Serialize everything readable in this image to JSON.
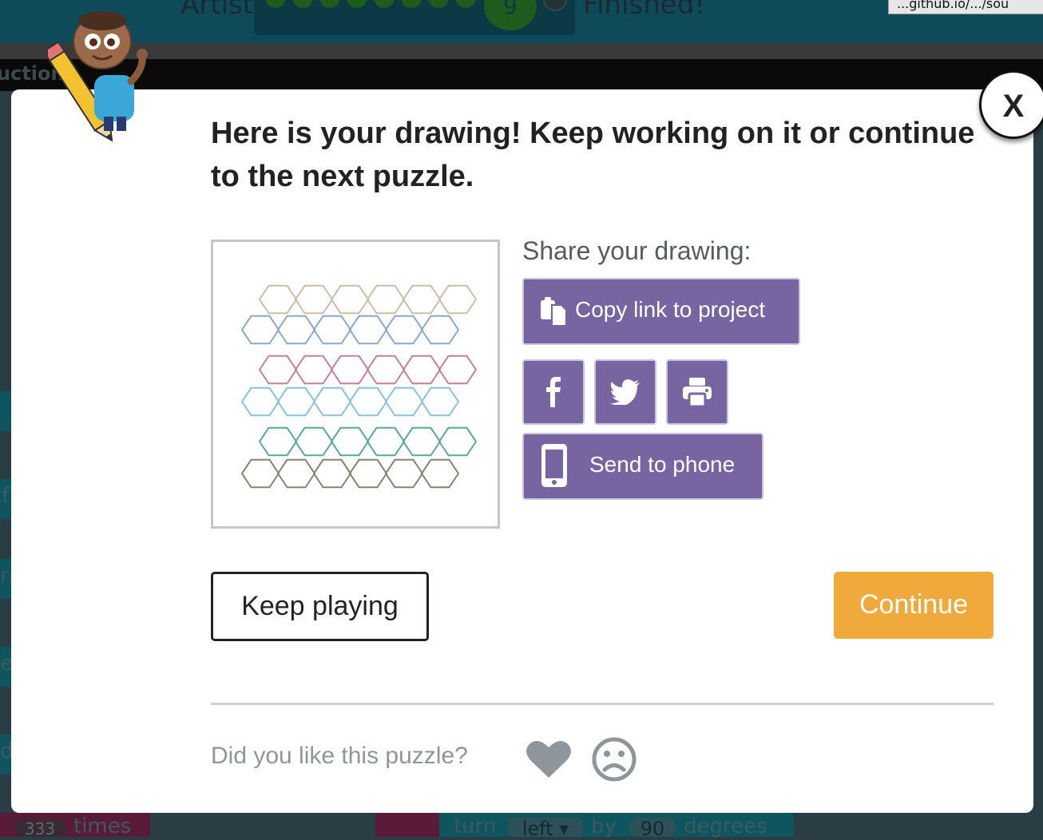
{
  "background": {
    "header_title": "Artist",
    "progress_current": "9",
    "status_text": "Finished!",
    "url_text": "...github.io/.../sou",
    "instructions_label": "uction",
    "bottom_blocks": {
      "repeat_count": "333",
      "repeat_unit": "times",
      "turn_word": "turn",
      "turn_direction": "left ▾",
      "by_word": "by",
      "turn_degrees": "90",
      "degrees_word": "degrees"
    },
    "left_edge_letters": [
      "f",
      "ri",
      "e",
      "d"
    ]
  },
  "modal": {
    "close_label": "X",
    "heading": "Here is your drawing! Keep working on it or continue to the next puzzle.",
    "share_label": "Share your drawing:",
    "copy_link_label": "Copy link to project",
    "send_to_phone_label": "Send to phone",
    "keep_playing_label": "Keep playing",
    "continue_label": "Continue",
    "feedback_question": "Did you like this puzzle?",
    "icons": {
      "copy": "clipboard-icon",
      "facebook": "facebook-icon",
      "twitter": "twitter-icon",
      "print": "print-icon",
      "phone": "phone-icon",
      "like": "heart-icon",
      "dislike": "sad-face-icon"
    },
    "colors": {
      "purple_button": "#7665a0",
      "continue_button": "#f0a93b",
      "hex_row_colors": [
        "#c9bea8",
        "#8aa7cf",
        "#c97f95",
        "#85c4db",
        "#5aa898",
        "#858470"
      ]
    }
  }
}
